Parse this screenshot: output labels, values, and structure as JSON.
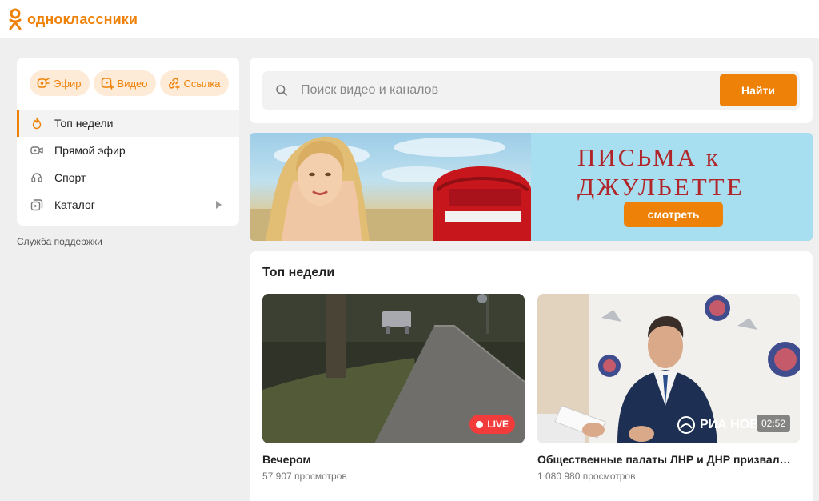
{
  "header": {
    "logo_text": "одноклассники"
  },
  "sidebar": {
    "chips": [
      {
        "label": "Эфир",
        "icon": "live-broadcast-icon"
      },
      {
        "label": "Видео",
        "icon": "video-add-icon"
      },
      {
        "label": "Ссылка",
        "icon": "link-icon"
      }
    ],
    "nav": [
      {
        "label": "Топ недели",
        "icon": "fire-icon",
        "active": true
      },
      {
        "label": "Прямой эфир",
        "icon": "live-camera-icon"
      },
      {
        "label": "Спорт",
        "icon": "sport-icon"
      },
      {
        "label": "Каталог",
        "icon": "catalog-icon"
      }
    ],
    "support_label": "Служба поддержки"
  },
  "search": {
    "placeholder": "Поиск видео и каналов",
    "value": "",
    "button_label": "Найти"
  },
  "banner": {
    "title": "ПИСЬМА к\nДЖУЛЬЕТТЕ",
    "button_label": "смотреть"
  },
  "section": {
    "title": "Топ недели",
    "videos": [
      {
        "title": "Вечером",
        "views": "57 907 просмотров",
        "badge": "LIVE"
      },
      {
        "title": "Общественные палаты ЛНР и ДНР призвал…",
        "views": "1 080 980 просмотров",
        "duration": "02:52",
        "watermark": "РИА НОВ"
      }
    ]
  },
  "colors": {
    "accent": "#ee8208",
    "live": "#f23b3b",
    "banner_title": "#b0252a"
  }
}
